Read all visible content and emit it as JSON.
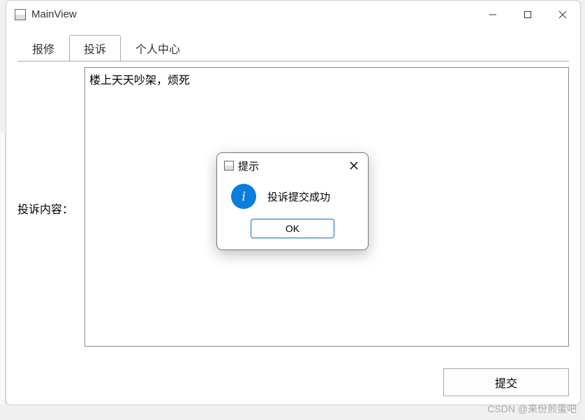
{
  "window": {
    "title": "MainView"
  },
  "tabs": [
    {
      "label": "报修"
    },
    {
      "label": "投诉"
    },
    {
      "label": "个人中心"
    }
  ],
  "form": {
    "label": "投诉内容：",
    "value": "楼上天天吵架，烦死",
    "submit_label": "提交"
  },
  "dialog": {
    "title": "提示",
    "message": "投诉提交成功",
    "ok_label": "OK",
    "icon_glyph": "i"
  },
  "watermark": "CSDN @来份煎蛋吧"
}
